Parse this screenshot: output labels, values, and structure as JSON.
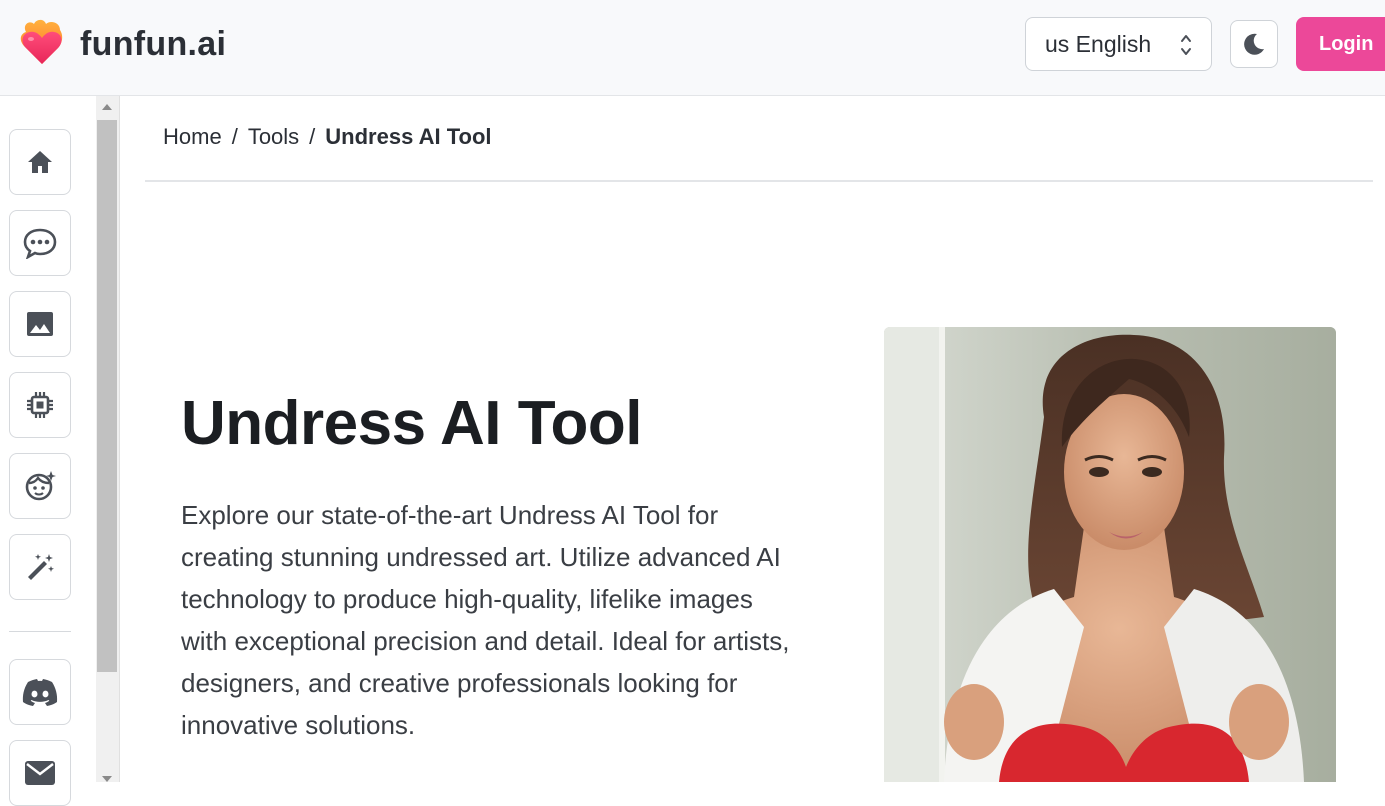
{
  "header": {
    "logo_text": "funfun.ai",
    "language": "us English",
    "login_label": "Login"
  },
  "sidebar": {
    "items": [
      {
        "icon": "home-icon"
      },
      {
        "icon": "chat-icon"
      },
      {
        "icon": "image-icon"
      },
      {
        "icon": "chip-icon"
      },
      {
        "icon": "face-sparkle-icon"
      },
      {
        "icon": "magic-wand-icon"
      },
      {
        "icon": "discord-icon"
      },
      {
        "icon": "mail-icon"
      }
    ]
  },
  "breadcrumb": {
    "home": "Home",
    "sep": "/",
    "tools": "Tools",
    "current": "Undress AI Tool"
  },
  "hero": {
    "title": "Undress AI Tool",
    "description": "Explore our state-of-the-art Undress AI Tool for creating stunning undressed art. Utilize advanced AI technology to produce high-quality, lifelike images with exceptional precision and detail. Ideal for artists, designers, and creative professionals looking for innovative solutions."
  },
  "colors": {
    "accent": "#ec4899",
    "icon": "#4b5058"
  }
}
